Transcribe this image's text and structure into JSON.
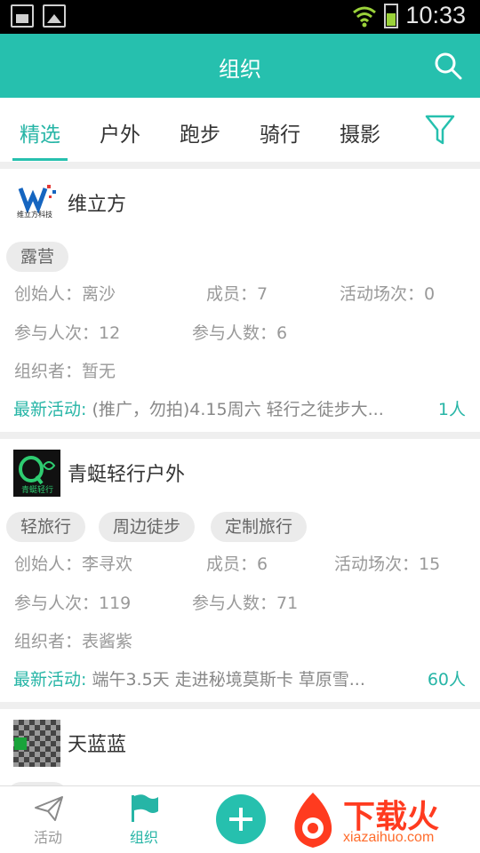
{
  "status_bar": {
    "time": "10:33"
  },
  "header": {
    "title": "组织"
  },
  "tabs": [
    {
      "label": "精选",
      "active": true
    },
    {
      "label": "户外",
      "active": false
    },
    {
      "label": "跑步",
      "active": false
    },
    {
      "label": "骑行",
      "active": false
    },
    {
      "label": "摄影",
      "active": false
    }
  ],
  "colors": {
    "accent": "#26c0ae",
    "tag_bg": "#ebebeb",
    "text_muted": "#999999"
  },
  "orgs": [
    {
      "name": "维立方",
      "logo_text": "维立方科技",
      "tags": [
        "露营"
      ],
      "founder": "创始人：离沙",
      "members": "成员：7",
      "events": "活动场次：0",
      "participations": "参与人次：12",
      "participants": "参与人数：6",
      "organizer": "组织者：暂无",
      "latest_label": "最新活动:",
      "latest_text": "(推广，勿拍)4.15周六 轻行之徒步大...",
      "latest_count": "1人"
    },
    {
      "name": "青蜓轻行户外",
      "logo_text": "青蜓轻行",
      "tags": [
        "轻旅行",
        "周边徒步",
        "定制旅行"
      ],
      "founder": "创始人：李寻欢",
      "members": "成员：6",
      "events": "活动场次：15",
      "participations": "参与人次：119",
      "participants": "参与人数：71",
      "organizer": "组织者：表酱紫",
      "latest_label": "最新活动:",
      "latest_text": "端午3.5天 走进秘境莫斯卡 草原雪...",
      "latest_count": "60人"
    },
    {
      "name": "天蓝蓝"
    }
  ],
  "bottom_nav": [
    {
      "label": "活动",
      "icon": "paper-plane-icon",
      "active": false
    },
    {
      "label": "组织",
      "icon": "flag-icon",
      "active": true
    }
  ],
  "watermark": {
    "brand": "下载火",
    "site": "xiazaihuo.com"
  }
}
